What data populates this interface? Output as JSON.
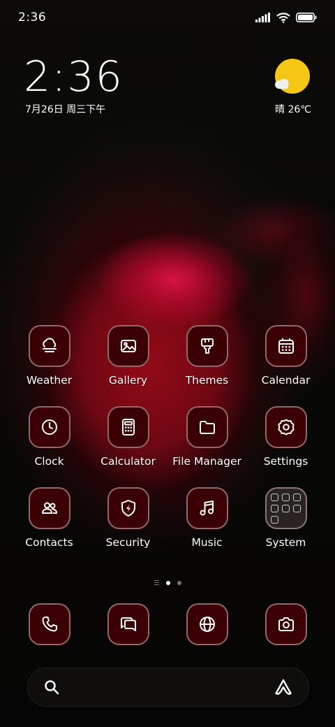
{
  "status_bar": {
    "time": "2:36"
  },
  "clock_widget": {
    "time": "2:36",
    "date": "7月26日 周三下午"
  },
  "weather_widget": {
    "text": "晴 26℃",
    "icon": "sun-cloud-icon",
    "sun_color": "#f6c615"
  },
  "apps": [
    {
      "label": "Weather",
      "icon": "weather-icon"
    },
    {
      "label": "Gallery",
      "icon": "gallery-icon"
    },
    {
      "label": "Themes",
      "icon": "themes-brush-icon"
    },
    {
      "label": "Calendar",
      "icon": "calendar-icon"
    },
    {
      "label": "Clock",
      "icon": "clock-icon"
    },
    {
      "label": "Calculator",
      "icon": "calculator-icon"
    },
    {
      "label": "File Manager",
      "icon": "folder-icon"
    },
    {
      "label": "Settings",
      "icon": "gear-icon"
    },
    {
      "label": "Contacts",
      "icon": "contacts-icon"
    },
    {
      "label": "Security",
      "icon": "security-shield-icon"
    },
    {
      "label": "Music",
      "icon": "music-note-icon"
    },
    {
      "label": "System",
      "icon": "system-folder-icon"
    }
  ],
  "page_indicator": {
    "pages": 2,
    "current": 1
  },
  "dock": [
    {
      "icon": "phone-icon"
    },
    {
      "icon": "messages-icon"
    },
    {
      "icon": "browser-globe-icon"
    },
    {
      "icon": "camera-icon"
    }
  ],
  "search_bar": {
    "left_icon": "search-icon",
    "right_icon": "assistant-icon"
  },
  "colors": {
    "icon_background": "#3a0004",
    "icon_border": "#e1bebe"
  }
}
